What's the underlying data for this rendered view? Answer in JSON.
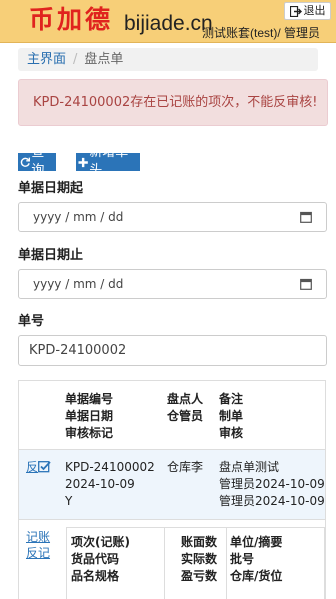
{
  "header": {
    "logo_cn": "币加德",
    "logo_en": "bijiade.cn",
    "user_info": "测试账套(test)/ 管理员",
    "logout_label": "退出",
    "logout_icon": "logout-icon"
  },
  "breadcrumb": {
    "home": "主界面",
    "current": "盘点单"
  },
  "alert": {
    "message": "KPD-24100002存在已记账的项次，不能反审核!"
  },
  "toolbar": {
    "query_label": "查询",
    "new_label": "新增单头",
    "query_icon": "refresh-icon",
    "new_icon": "plus-icon"
  },
  "filters": {
    "date_start_label": "单据日期起",
    "date_start_placeholder": "yyyy / mm / dd",
    "date_end_label": "单据日期止",
    "date_end_placeholder": "yyyy / mm / dd",
    "doc_no_label": "单号",
    "doc_no_value": "KPD-24100002"
  },
  "grid": {
    "headers": {
      "col1": [
        "单据编号",
        "单据日期",
        "审核标记"
      ],
      "col2": [
        "盘点人",
        "仓管员"
      ],
      "col3": [
        "备注",
        "制单",
        "审核"
      ]
    },
    "row": {
      "action_label": "反",
      "col1": [
        "KPD-24100002",
        "2024-10-09",
        "Y"
      ],
      "col2": [
        "仓库李"
      ],
      "col3": [
        "盘点单测试",
        "管理员2024-10-09",
        "管理员2024-10-09"
      ]
    },
    "detail": {
      "links": [
        "记账",
        "反记"
      ],
      "headers": {
        "col1": [
          "项次(记账)",
          "货品代码",
          "品名规格"
        ],
        "col2": [
          "账面数",
          "实际数",
          "盈亏数"
        ],
        "col3": [
          "单位/摘要",
          "批号",
          "仓库/货位"
        ]
      }
    }
  },
  "colors": {
    "header_bg": "#f7cf78",
    "logo_red": "#e0231e",
    "primary": "#2b74b8",
    "alert_bg": "#f2dede",
    "alert_text": "#a94442"
  }
}
